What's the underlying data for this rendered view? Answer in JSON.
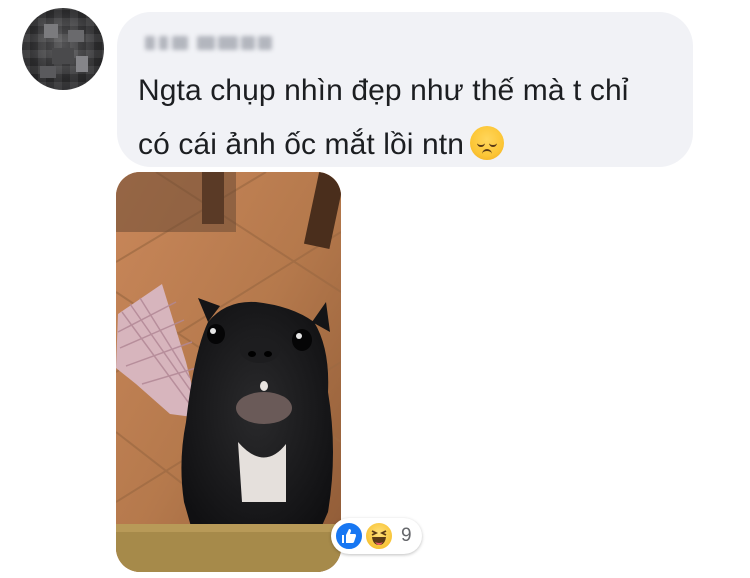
{
  "comment": {
    "author_name": "",
    "text_line1": "Ngta chụp nhìn đẹp như thế mà t chỉ",
    "text_line2": "có cái ảnh ốc mắt lồi ntn",
    "emoji_icon": "disappointed-face-emoji"
  },
  "reactions": {
    "icons": [
      "like-icon",
      "haha-icon"
    ],
    "count": "9"
  },
  "colors": {
    "bubble": "#f1f2f6",
    "text": "#1c1e21",
    "like_blue": "#1877f2",
    "reaction_count": "#65676b"
  }
}
